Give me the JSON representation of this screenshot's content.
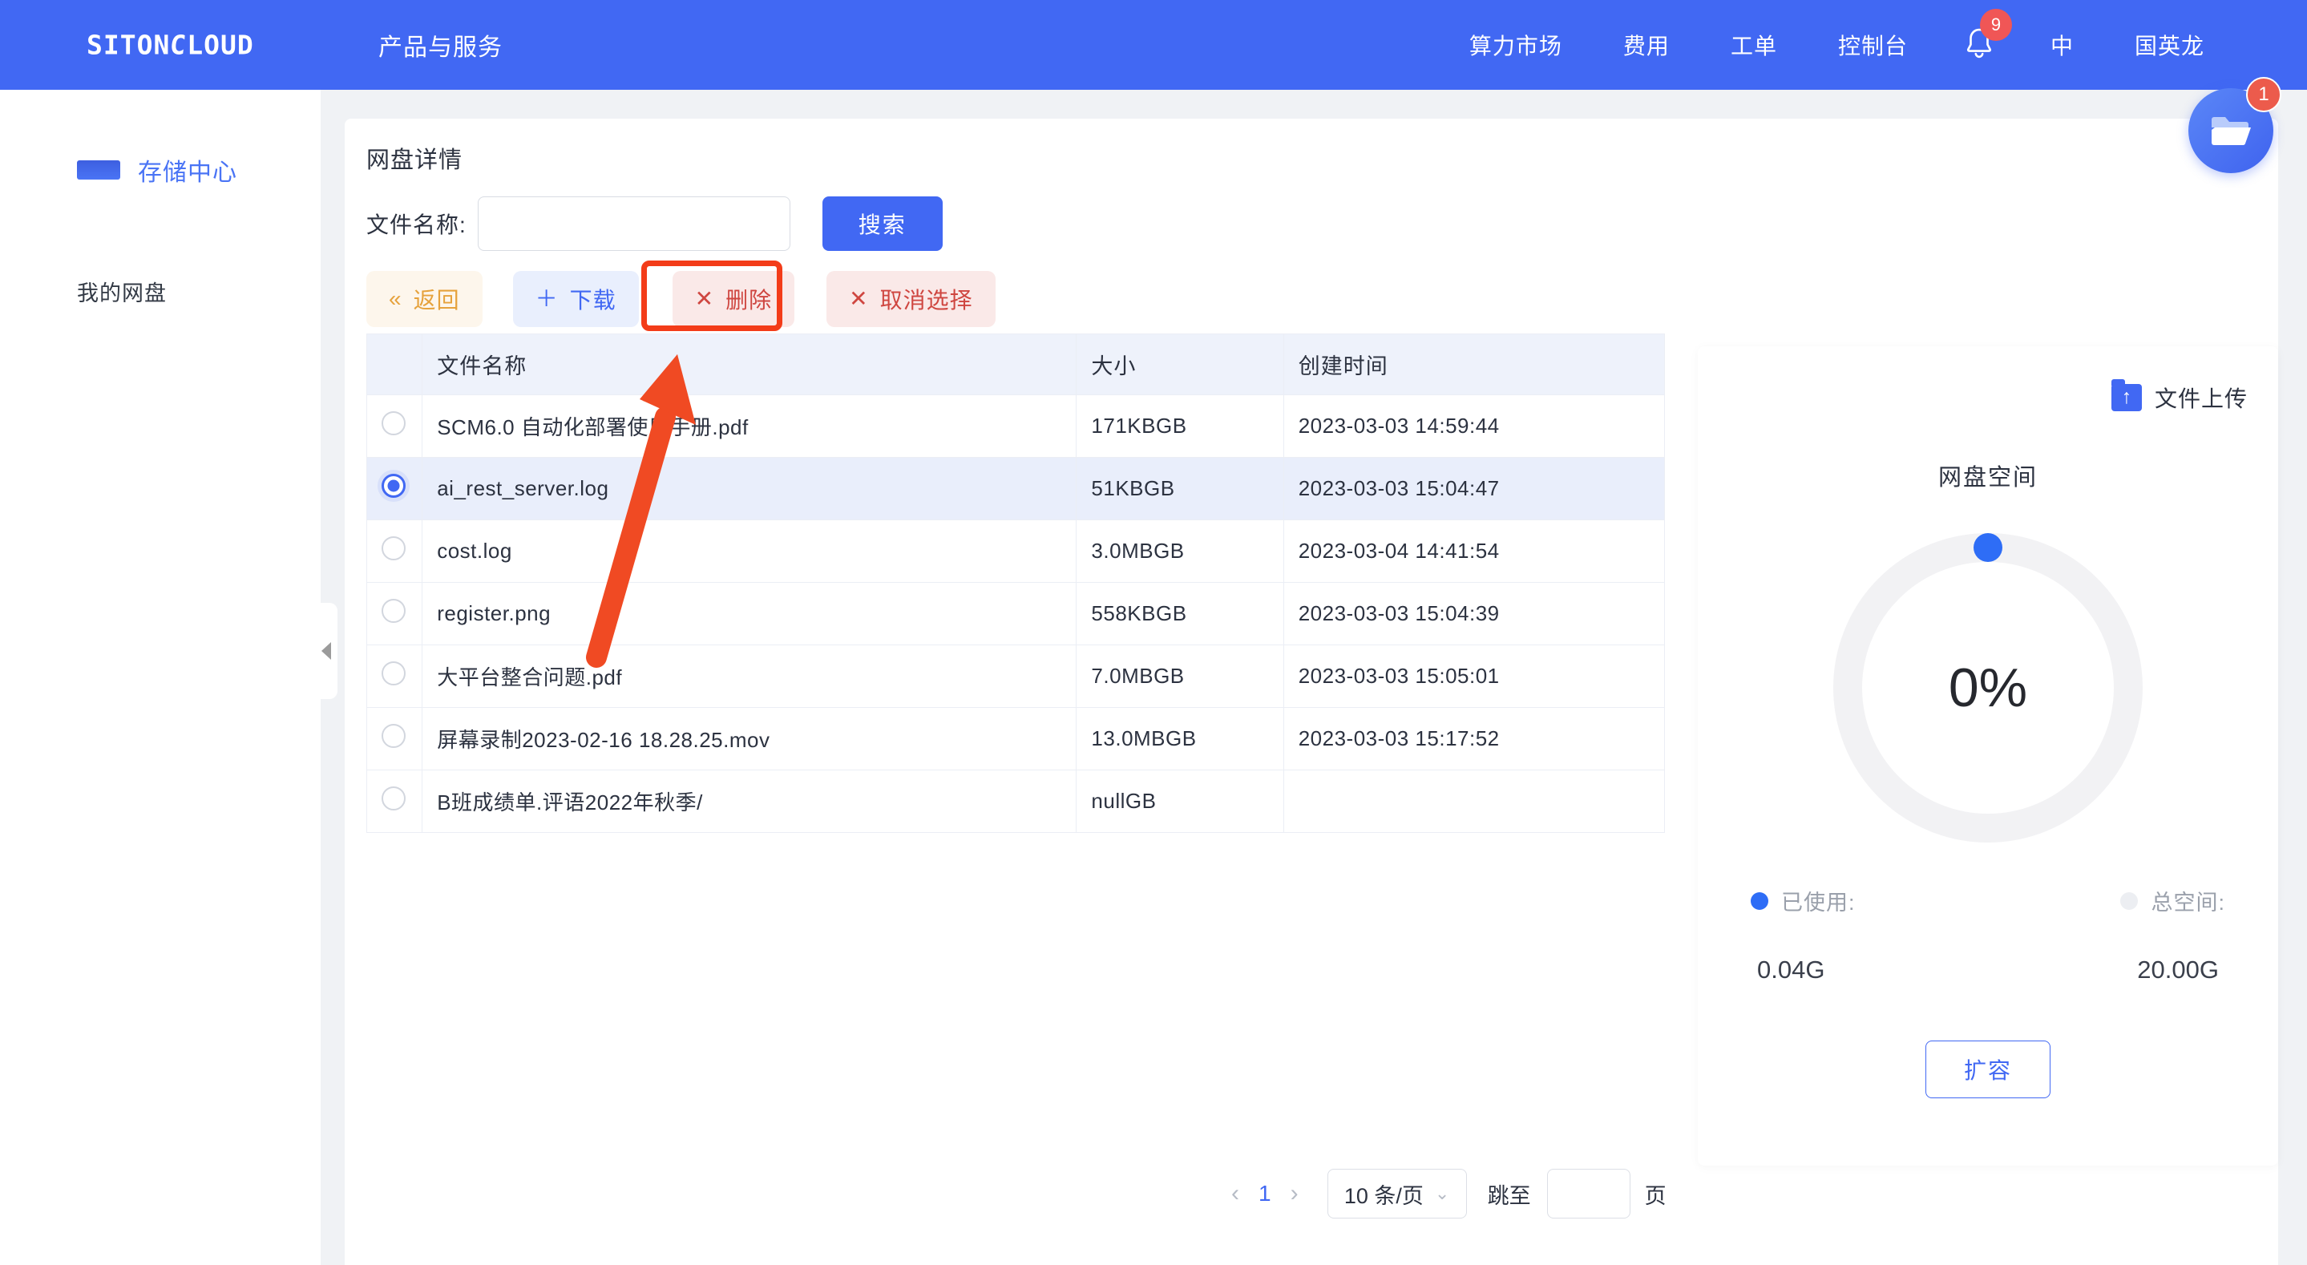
{
  "header": {
    "logo_part1": "SITON",
    "logo_part2": "C",
    "logo_part3": "LOUD",
    "primary_nav": "产品与服务",
    "nav_items": [
      {
        "label": "算力市场"
      },
      {
        "label": "费用"
      },
      {
        "label": "工单"
      },
      {
        "label": "控制台"
      }
    ],
    "bell_icon": "bell-icon",
    "bell_badge": "9",
    "lang": "中",
    "user": "国英龙"
  },
  "sidebar": {
    "section_label": "存储中心",
    "items": [
      {
        "label": "我的网盘"
      }
    ]
  },
  "main": {
    "page_title": "网盘详情",
    "search": {
      "label": "文件名称:",
      "value": "",
      "placeholder": "",
      "button": "搜索"
    },
    "actions": [
      {
        "name": "back",
        "icon": "«",
        "label": "返回"
      },
      {
        "name": "download",
        "icon": "＋",
        "label": "下载"
      },
      {
        "name": "delete",
        "icon": "✕",
        "label": "删除"
      },
      {
        "name": "cancel",
        "icon": "✕",
        "label": "取消选择"
      }
    ],
    "table": {
      "columns": [
        "",
        "文件名称",
        "大小",
        "创建时间"
      ],
      "rows": [
        {
          "selected": false,
          "name": "SCM6.0 自动化部署使用手册.pdf",
          "size": "171KBGB",
          "created": "2023-03-03 14:59:44"
        },
        {
          "selected": true,
          "name": "ai_rest_server.log",
          "size": "51KBGB",
          "created": "2023-03-03 15:04:47"
        },
        {
          "selected": false,
          "name": "cost.log",
          "size": "3.0MBGB",
          "created": "2023-03-04 14:41:54"
        },
        {
          "selected": false,
          "name": "register.png",
          "size": "558KBGB",
          "created": "2023-03-03 15:04:39"
        },
        {
          "selected": false,
          "name": "大平台整合问题.pdf",
          "size": "7.0MBGB",
          "created": "2023-03-03 15:05:01"
        },
        {
          "selected": false,
          "name": "屏幕录制2023-02-16 18.28.25.mov",
          "size": "13.0MBGB",
          "created": "2023-03-03 15:17:52"
        },
        {
          "selected": false,
          "name": "B班成绩单.评语2022年秋季/",
          "size": "nullGB",
          "created": ""
        }
      ]
    },
    "pagination": {
      "prev_icon": "‹",
      "current_page": "1",
      "next_icon": "›",
      "page_size": "10 条/页",
      "chevron_icon": "⌄",
      "jump_label": "跳至",
      "jump_value": "",
      "page_unit": "页"
    }
  },
  "disk_panel": {
    "upload_label": "文件上传",
    "upload_icon": "folder-upload-icon",
    "title": "网盘空间",
    "percent_text": "0%",
    "legend": [
      {
        "label": "已使用:",
        "color": "#2e6df6"
      },
      {
        "label": "总空间:",
        "color": "#eceef2"
      }
    ],
    "values": [
      "0.04G",
      "20.00G"
    ],
    "expand_button": "扩容"
  },
  "fab": {
    "icon": "folder-open-icon",
    "badge": "1"
  },
  "annotation": {
    "highlight_color": "#f33c19",
    "arrow_color": "#f04a23",
    "target": "delete"
  },
  "chart_data": {
    "type": "pie",
    "title": "网盘空间",
    "categories": [
      "已使用:",
      "总空间:"
    ],
    "values": [
      0.04,
      20.0
    ],
    "value_labels": [
      "0.04G",
      "20.00G"
    ],
    "percent_used": 0,
    "center_label": "0%",
    "colors": [
      "#2e6df6",
      "#eceef2"
    ],
    "legend": "bottom"
  }
}
